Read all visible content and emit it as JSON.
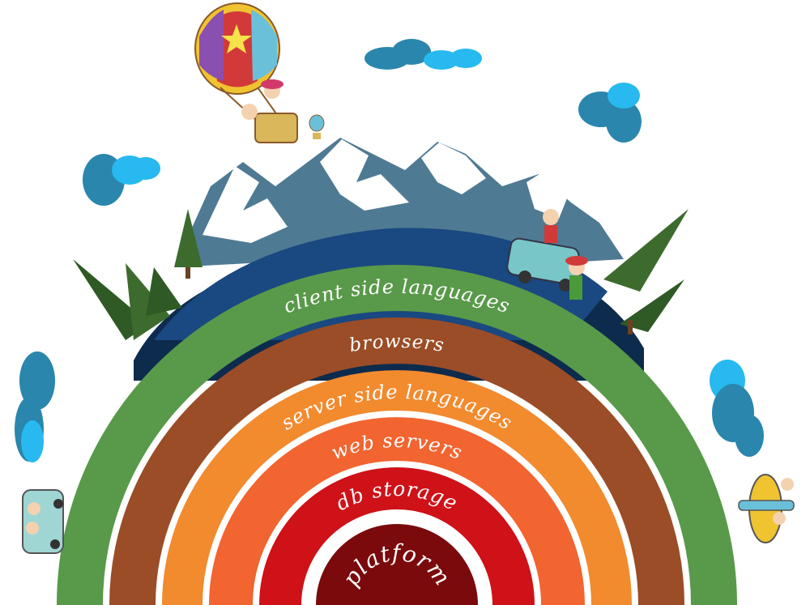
{
  "layers": [
    {
      "label": "client side languages",
      "color": "#59994a"
    },
    {
      "label": "browsers",
      "color": "#9a4d26"
    },
    {
      "label": "server side languages",
      "color": "#f28a2e"
    },
    {
      "label": "web servers",
      "color": "#f26430"
    },
    {
      "label": "db storage",
      "color": "#cf1118"
    },
    {
      "label": "platform",
      "color": "#7a0a0c"
    }
  ],
  "colors": {
    "hill_dark": "#0d2b4d",
    "hill_mid": "#1a4880",
    "mountain": "#4f7a93",
    "snow": "#ffffff",
    "cloud_dark": "#2a86ad",
    "cloud_light": "#27b9ef",
    "tree": "#3d6b2e"
  },
  "decorations": [
    "hot-air-balloon",
    "small-balloon",
    "jeep-with-children",
    "toy-car",
    "toy-airplane",
    "pine-tree",
    "cloud",
    "mountain"
  ]
}
